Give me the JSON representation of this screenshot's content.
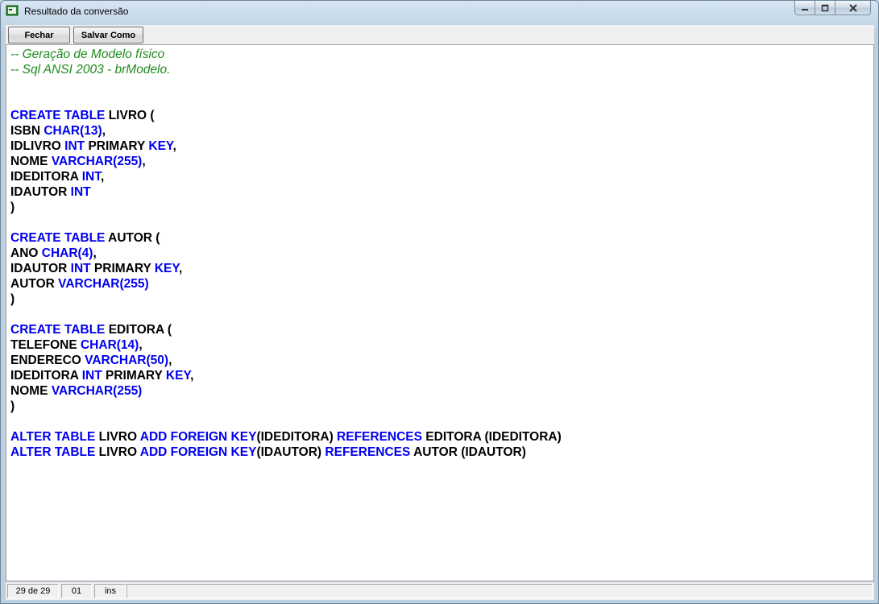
{
  "window": {
    "title": "Resultado da conversão"
  },
  "toolbar": {
    "close_label": "Fechar",
    "save_label": "Salvar Como"
  },
  "editor": {
    "lines": [
      [
        {
          "t": "-- Geração de Modelo físico",
          "c": "cm"
        }
      ],
      [
        {
          "t": "-- Sql ANSI 2003 - brModelo.",
          "c": "cm"
        }
      ],
      [],
      [],
      [
        {
          "t": "CREATE TABLE",
          "c": "kw"
        },
        {
          "t": " LIVRO ("
        }
      ],
      [
        {
          "t": "ISBN "
        },
        {
          "t": "CHAR(13)",
          "c": "kw"
        },
        {
          "t": ","
        }
      ],
      [
        {
          "t": "IDLIVRO "
        },
        {
          "t": "INT",
          "c": "kw"
        },
        {
          "t": " PRIMARY "
        },
        {
          "t": "KEY",
          "c": "kw"
        },
        {
          "t": ","
        }
      ],
      [
        {
          "t": "NOME "
        },
        {
          "t": "VARCHAR(255)",
          "c": "kw"
        },
        {
          "t": ","
        }
      ],
      [
        {
          "t": "IDEDITORA "
        },
        {
          "t": "INT",
          "c": "kw"
        },
        {
          "t": ","
        }
      ],
      [
        {
          "t": "IDAUTOR "
        },
        {
          "t": "INT",
          "c": "kw"
        }
      ],
      [
        {
          "t": ")"
        }
      ],
      [],
      [
        {
          "t": "CREATE TABLE",
          "c": "kw"
        },
        {
          "t": " AUTOR ("
        }
      ],
      [
        {
          "t": "ANO "
        },
        {
          "t": "CHAR(4)",
          "c": "kw"
        },
        {
          "t": ","
        }
      ],
      [
        {
          "t": "IDAUTOR "
        },
        {
          "t": "INT",
          "c": "kw"
        },
        {
          "t": " PRIMARY "
        },
        {
          "t": "KEY",
          "c": "kw"
        },
        {
          "t": ","
        }
      ],
      [
        {
          "t": "AUTOR "
        },
        {
          "t": "VARCHAR(255)",
          "c": "kw"
        }
      ],
      [
        {
          "t": ")"
        }
      ],
      [],
      [
        {
          "t": "CREATE TABLE",
          "c": "kw"
        },
        {
          "t": " EDITORA ("
        }
      ],
      [
        {
          "t": "TELEFONE "
        },
        {
          "t": "CHAR(14)",
          "c": "kw"
        },
        {
          "t": ","
        }
      ],
      [
        {
          "t": "ENDERECO "
        },
        {
          "t": "VARCHAR(50)",
          "c": "kw"
        },
        {
          "t": ","
        }
      ],
      [
        {
          "t": "IDEDITORA "
        },
        {
          "t": "INT",
          "c": "kw"
        },
        {
          "t": " PRIMARY "
        },
        {
          "t": "KEY",
          "c": "kw"
        },
        {
          "t": ","
        }
      ],
      [
        {
          "t": "NOME "
        },
        {
          "t": "VARCHAR(255)",
          "c": "kw"
        }
      ],
      [
        {
          "t": ")"
        }
      ],
      [],
      [
        {
          "t": "ALTER TABLE",
          "c": "kw"
        },
        {
          "t": " LIVRO "
        },
        {
          "t": "ADD FOREIGN KEY",
          "c": "kw"
        },
        {
          "t": "(IDEDITORA) "
        },
        {
          "t": "REFERENCES",
          "c": "kw"
        },
        {
          "t": " EDITORA (IDEDITORA)"
        }
      ],
      [
        {
          "t": "ALTER TABLE",
          "c": "kw"
        },
        {
          "t": " LIVRO "
        },
        {
          "t": "ADD FOREIGN KEY",
          "c": "kw"
        },
        {
          "t": "(IDAUTOR) "
        },
        {
          "t": "REFERENCES",
          "c": "kw"
        },
        {
          "t": " AUTOR (IDAUTOR)"
        }
      ]
    ]
  },
  "status": {
    "position": "29 de 29",
    "column": "01",
    "mode": "ins"
  },
  "colors": {
    "keyword": "#0000ee",
    "comment": "#1f8a1f",
    "text": "#000000"
  },
  "icons": [
    "app-icon",
    "minimize-icon",
    "maximize-icon",
    "close-icon"
  ]
}
